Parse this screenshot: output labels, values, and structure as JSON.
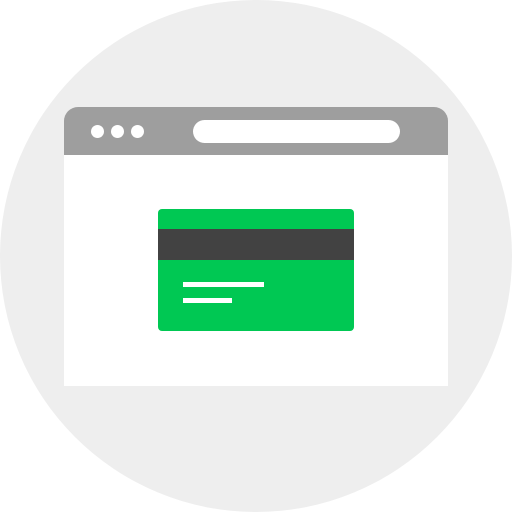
{
  "colors": {
    "background_circle": "#eeeeee",
    "browser_bar": "#9e9e9e",
    "browser_body": "#ffffff",
    "window_dots": "#ffffff",
    "address_bar": "#ffffff",
    "card": "#00c853",
    "card_stripe": "#424242",
    "card_text_lines": "#ffffff"
  },
  "icons": {
    "browser_window": "browser-window-icon",
    "credit_card": "credit-card-icon"
  }
}
